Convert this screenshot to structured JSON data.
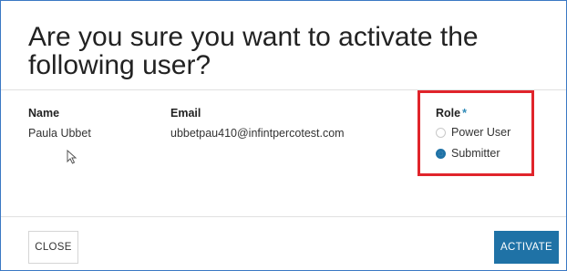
{
  "dialog": {
    "title": "Are you sure you want to activate the following user?"
  },
  "user": {
    "name_label": "Name",
    "name_value": "Paula Ubbet",
    "email_label": "Email",
    "email_value": "ubbetpau410@infintpercotest.com"
  },
  "role": {
    "label": "Role",
    "required_marker": "*",
    "options": [
      {
        "label": "Power User",
        "selected": false
      },
      {
        "label": "Submitter",
        "selected": true
      }
    ]
  },
  "footer": {
    "close_label": "CLOSE",
    "activate_label": "ACTIVATE"
  },
  "colors": {
    "accent": "#1f72a6",
    "highlight_border": "#e0242b",
    "frame_border": "#3b78c4",
    "required_marker": "#2f8ab8"
  },
  "icons": {
    "cursor": "mouse-cursor-icon"
  }
}
